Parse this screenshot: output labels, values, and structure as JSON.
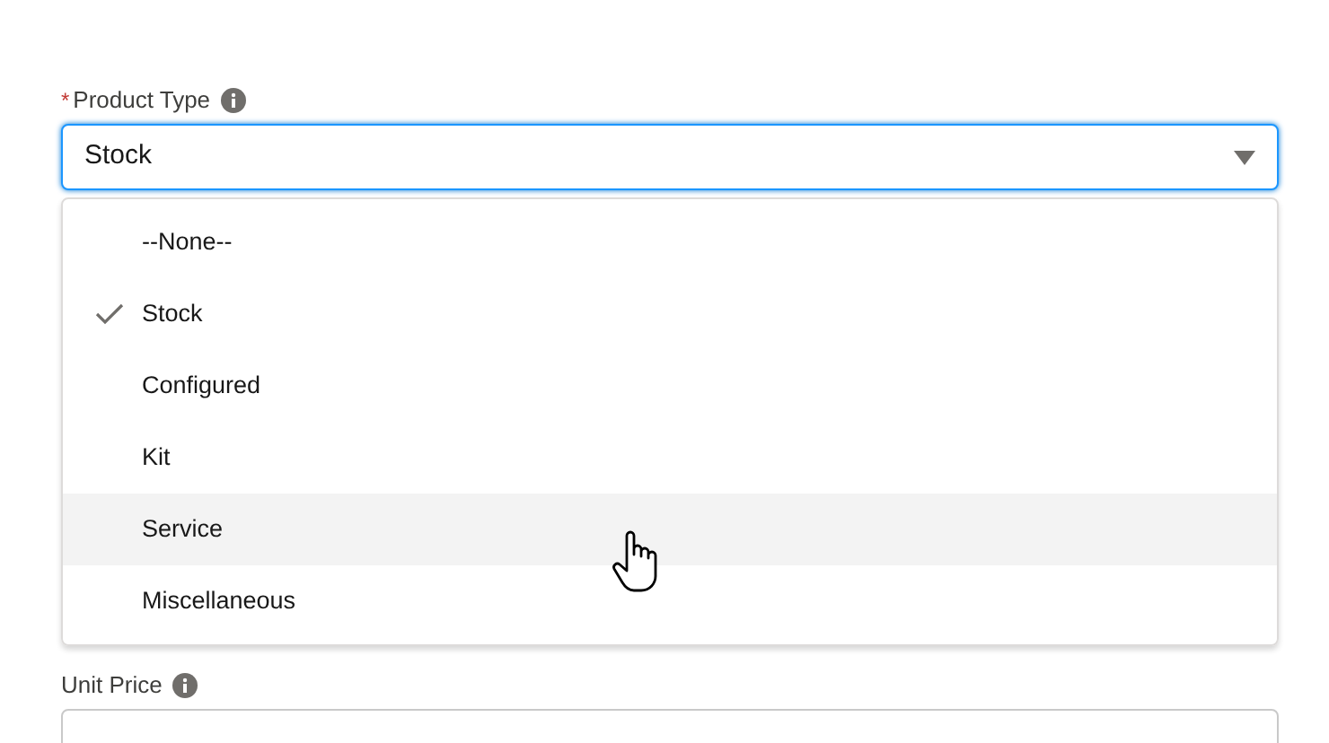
{
  "fields": [
    {
      "label": "Product Type",
      "required": true,
      "required_mark": "*",
      "value": "Stock",
      "open": true,
      "options": [
        {
          "label": "--None--",
          "selected": false,
          "hovered": false
        },
        {
          "label": "Stock",
          "selected": true,
          "hovered": false
        },
        {
          "label": "Configured",
          "selected": false,
          "hovered": false
        },
        {
          "label": "Kit",
          "selected": false,
          "hovered": false
        },
        {
          "label": "Service",
          "selected": false,
          "hovered": true
        },
        {
          "label": "Miscellaneous",
          "selected": false,
          "hovered": false
        }
      ]
    },
    {
      "label": "Unit Price",
      "required": false,
      "open": false
    }
  ]
}
